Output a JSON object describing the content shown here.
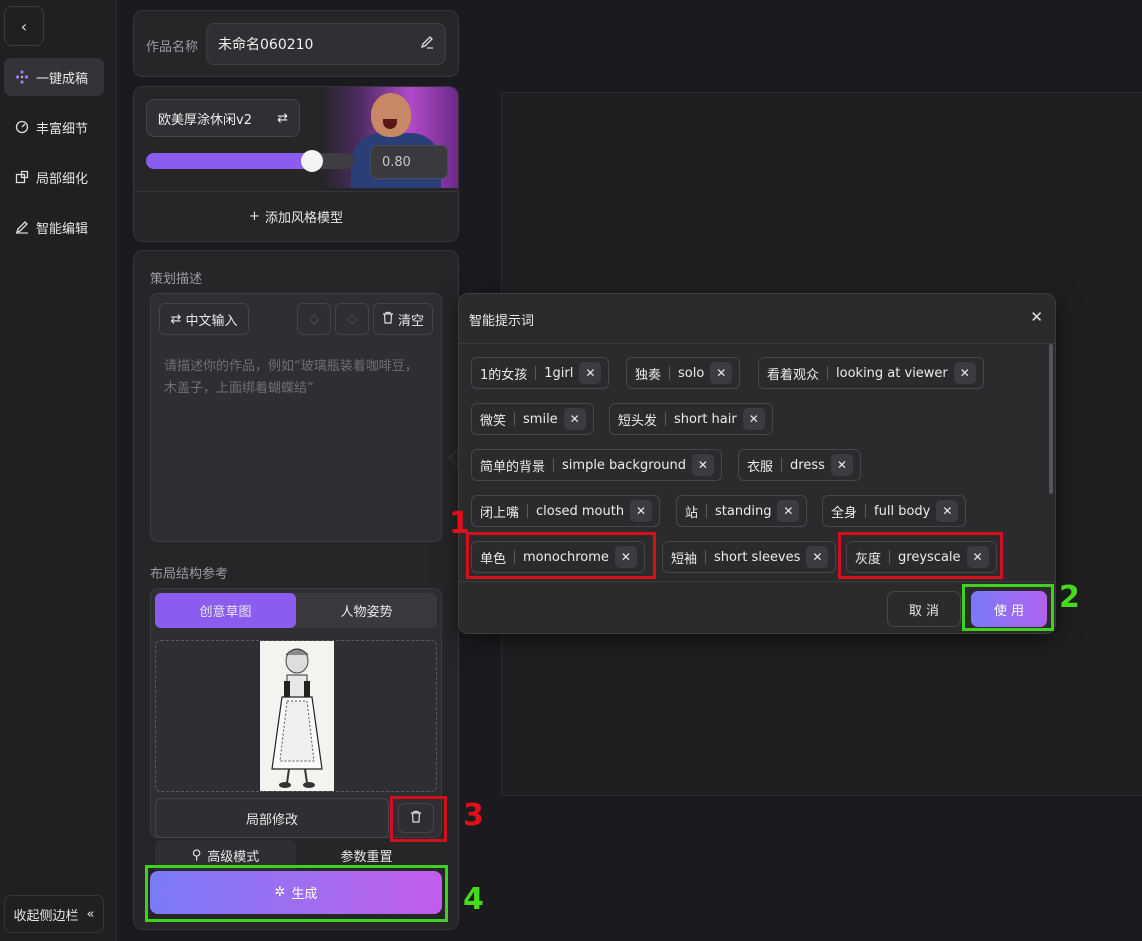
{
  "nav": {
    "items": [
      {
        "label": "一键成稿",
        "icon": "sparkle-grid-icon",
        "active": true
      },
      {
        "label": "丰富细节",
        "icon": "gauge-icon",
        "active": false
      },
      {
        "label": "局部细化",
        "icon": "crop-icon",
        "active": false
      },
      {
        "label": "智能编辑",
        "icon": "pen-icon",
        "active": false
      }
    ],
    "collapse_label": "收起侧边栏"
  },
  "work": {
    "name_label": "作品名称",
    "name_value": "未命名060210"
  },
  "style_model": {
    "name": "欧美厚涂休闲v2",
    "strength": 0.8,
    "strength_text": "0.80",
    "add_label": "添加风格模型"
  },
  "prompt": {
    "section_label": "策划描述",
    "zh_input_label": "中文输入",
    "clear_label": "清空",
    "placeholder": "请描述你的作品，例如“玻璃瓶装着咖啡豆，木盖子，上面绑着蝴蝶结”"
  },
  "layout_ref": {
    "section_label": "布局结构参考",
    "tabs": [
      "创意草图",
      "人物姿势"
    ],
    "local_edit_label": "局部修改"
  },
  "footer": {
    "advanced_label": "高级模式",
    "reset_label": "参数重置",
    "generate_label": "生成"
  },
  "popup": {
    "title": "智能提示词",
    "tags": [
      {
        "zh": "1的女孩",
        "en": "1girl"
      },
      {
        "zh": "独奏",
        "en": "solo"
      },
      {
        "zh": "看着观众",
        "en": "looking at viewer"
      },
      {
        "zh": "微笑",
        "en": "smile"
      },
      {
        "zh": "短头发",
        "en": "short hair"
      },
      {
        "zh": "简单的背景",
        "en": "simple background"
      },
      {
        "zh": "衣服",
        "en": "dress"
      },
      {
        "zh": "闭上嘴",
        "en": "closed mouth"
      },
      {
        "zh": "站",
        "en": "standing"
      },
      {
        "zh": "全身",
        "en": "full body"
      },
      {
        "zh": "单色",
        "en": "monochrome"
      },
      {
        "zh": "短袖",
        "en": "short sleeves"
      },
      {
        "zh": "灰度",
        "en": "greyscale"
      }
    ],
    "cancel_label": "取 消",
    "use_label": "使 用"
  },
  "annotations": [
    "1",
    "2",
    "3",
    "4"
  ],
  "colors": {
    "accent": "#8a5cf0",
    "annotation_red": "#d0101a",
    "annotation_green": "#3ed21c"
  }
}
